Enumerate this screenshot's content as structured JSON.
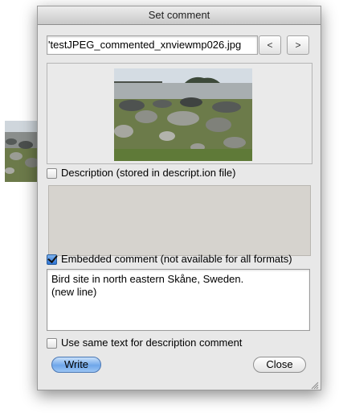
{
  "dialog": {
    "title": "Set comment",
    "filename": "'testJPEG_commented_xnviewmp026.jpg",
    "prev_label": "<",
    "next_label": ">"
  },
  "description": {
    "checkbox_label": "Description (stored in descript.ion file)",
    "checked": false,
    "text": ""
  },
  "embedded": {
    "checkbox_label": "Embedded comment (not available for all formats)",
    "checked": true,
    "text_line1": "Bird site in north eastern Skåne, Sweden.",
    "text_line2": "(new line)"
  },
  "same_text": {
    "checkbox_label": "Use same text for description  comment",
    "checked": false
  },
  "buttons": {
    "write_label": "Write",
    "close_label": "Close"
  }
}
